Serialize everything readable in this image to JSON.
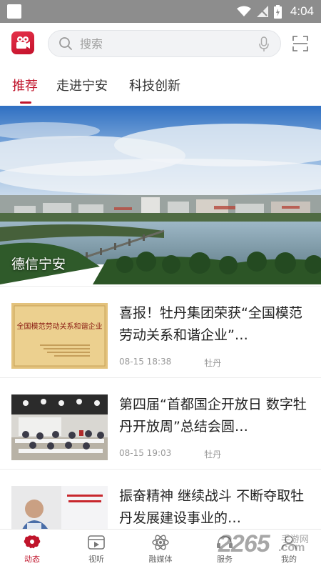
{
  "status_bar": {
    "time": "4:04"
  },
  "header": {
    "search_placeholder": "搜索"
  },
  "tabs": [
    {
      "label": "推荐",
      "active": true
    },
    {
      "label": "走进宁安",
      "active": false
    },
    {
      "label": "科技创新",
      "active": false
    }
  ],
  "banner": {
    "caption": "德信宁安"
  },
  "news": [
    {
      "title": "喜报！牡丹集团荣获“全国模范劳动关系和谐企业”…",
      "date": "08-15 18:38",
      "source": "牡丹",
      "thumb_text": "全国模范劳动关系和谐企业"
    },
    {
      "title": "第四届“首都国企开放日 数字牡丹开放周”总结会圆…",
      "date": "08-15 19:03",
      "source": "牡丹"
    },
    {
      "title": "振奋精神 继续战斗 不断夺取牡丹发展建设事业的…",
      "date": "",
      "source": ""
    }
  ],
  "bottom_nav": [
    {
      "label": "动态",
      "icon": "peony-icon",
      "active": true
    },
    {
      "label": "视听",
      "icon": "video-icon",
      "active": false
    },
    {
      "label": "融媒体",
      "icon": "atom-icon",
      "active": false
    },
    {
      "label": "服务",
      "icon": "service-icon",
      "active": false
    },
    {
      "label": "我的",
      "icon": "user-icon",
      "active": false
    }
  ],
  "watermark": {
    "brand": "2265",
    "suffix": ".com",
    "sub": "手游网"
  },
  "colors": {
    "accent": "#c0142b",
    "status_bar": "#8d8d8d"
  }
}
